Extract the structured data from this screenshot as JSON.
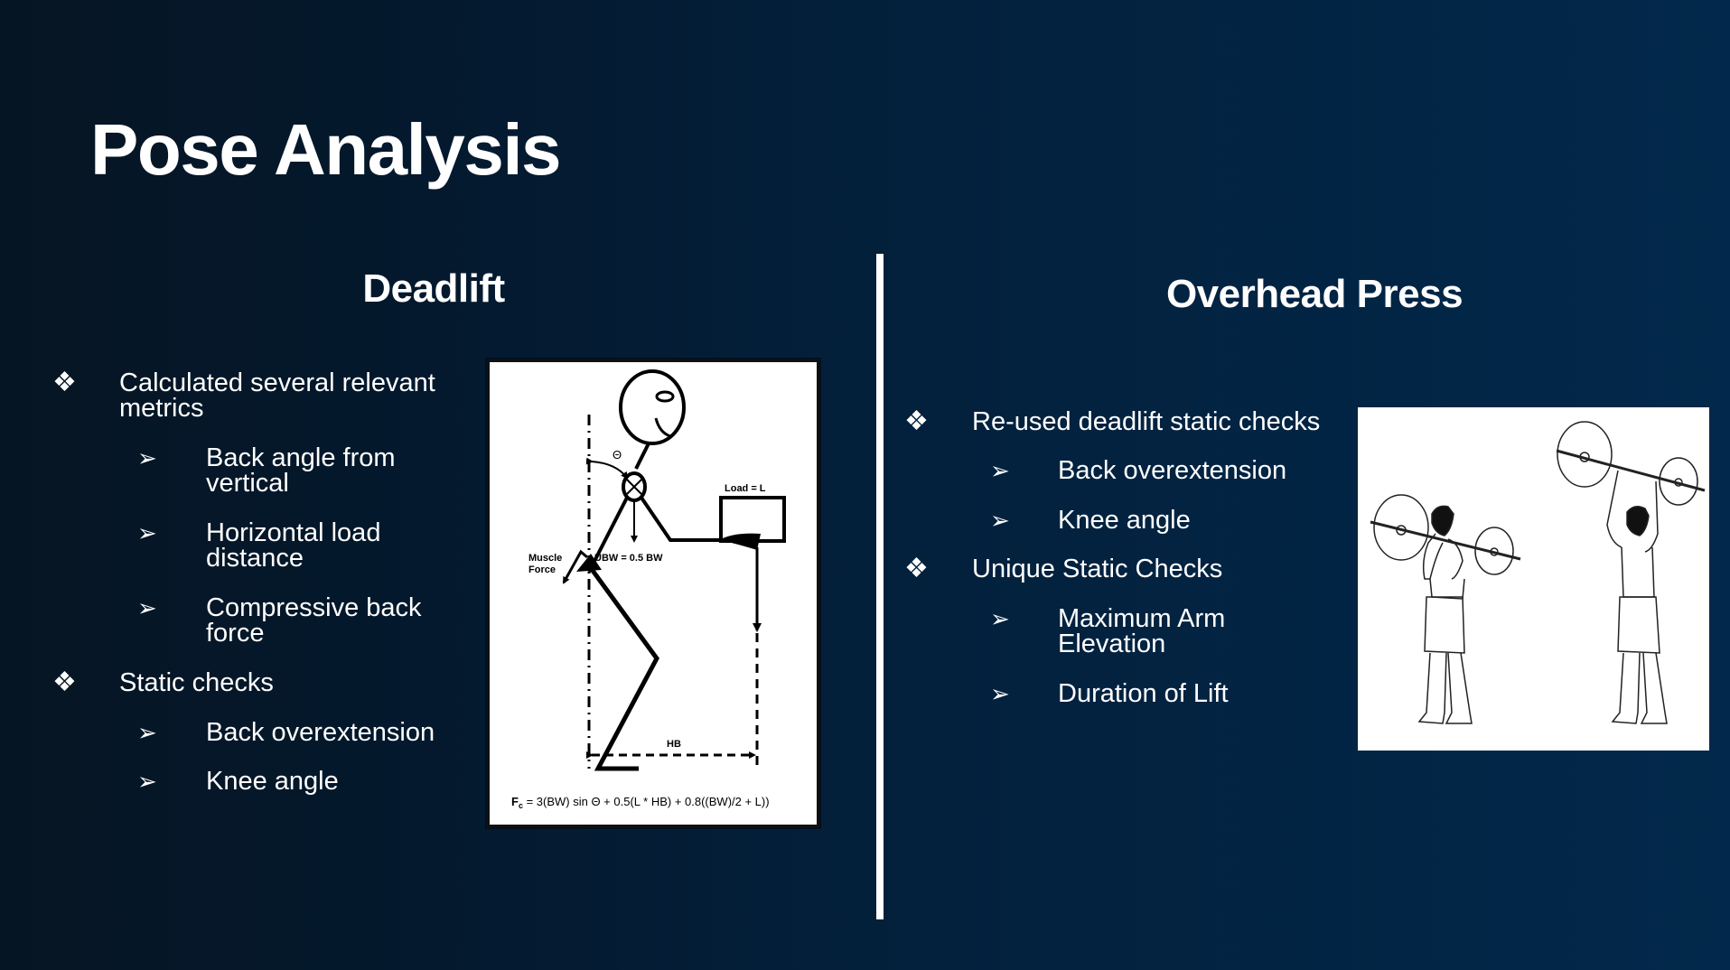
{
  "slide": {
    "title": "Pose Analysis",
    "colors": {
      "background_left": "#061523",
      "background_right": "#02284b",
      "text": "#ffffff",
      "divider": "#ffffff"
    }
  },
  "deadlift": {
    "heading": "Deadlift",
    "bullets": [
      {
        "icon": "diamond-bullet-icon",
        "marker": "❖",
        "lines": [
          "Calculated several relevant",
          "metrics"
        ]
      },
      {
        "icon": "arrow-bullet-icon",
        "marker": "➢",
        "lines": [
          "Back angle from",
          "vertical"
        ]
      },
      {
        "icon": "arrow-bullet-icon",
        "marker": "➢",
        "lines": [
          "Horizontal load",
          "distance"
        ]
      },
      {
        "icon": "arrow-bullet-icon",
        "marker": "➢",
        "lines": [
          "Compressive back",
          "force"
        ]
      },
      {
        "icon": "diamond-bullet-icon",
        "marker": "❖",
        "lines": [
          "Static checks"
        ]
      },
      {
        "icon": "arrow-bullet-icon",
        "marker": "➢",
        "lines": [
          "Back overextension"
        ]
      },
      {
        "icon": "arrow-bullet-icon",
        "marker": "➢",
        "lines": [
          "Knee angle"
        ]
      }
    ],
    "diagram": {
      "theta_label": "Θ",
      "load_label": "Load = L",
      "muscle_label_1": "Muscle",
      "muscle_label_2": "Force",
      "ubw_label": "UBW = 0.5 BW",
      "hb_label": "HB",
      "formula_f": "F",
      "formula_sub": "c",
      "formula_rest": " = 3(BW) sin Θ + 0.5(L * HB) + 0.8((BW)/2 + L))"
    }
  },
  "overhead_press": {
    "heading": "Overhead Press",
    "bullets": [
      {
        "icon": "diamond-bullet-icon",
        "marker": "❖",
        "lines": [
          "Re-used deadlift static checks"
        ]
      },
      {
        "icon": "arrow-bullet-icon",
        "marker": "➢",
        "lines": [
          "Back overextension"
        ]
      },
      {
        "icon": "arrow-bullet-icon",
        "marker": "➢",
        "lines": [
          "Knee angle"
        ]
      },
      {
        "icon": "diamond-bullet-icon",
        "marker": "❖",
        "lines": [
          "Unique Static Checks"
        ]
      },
      {
        "icon": "arrow-bullet-icon",
        "marker": "➢",
        "lines": [
          "Maximum Arm",
          "Elevation"
        ]
      },
      {
        "icon": "arrow-bullet-icon",
        "marker": "➢",
        "lines": [
          "Duration of Lift"
        ]
      }
    ],
    "illustration": "two-figures-barbell-overhead-press"
  }
}
